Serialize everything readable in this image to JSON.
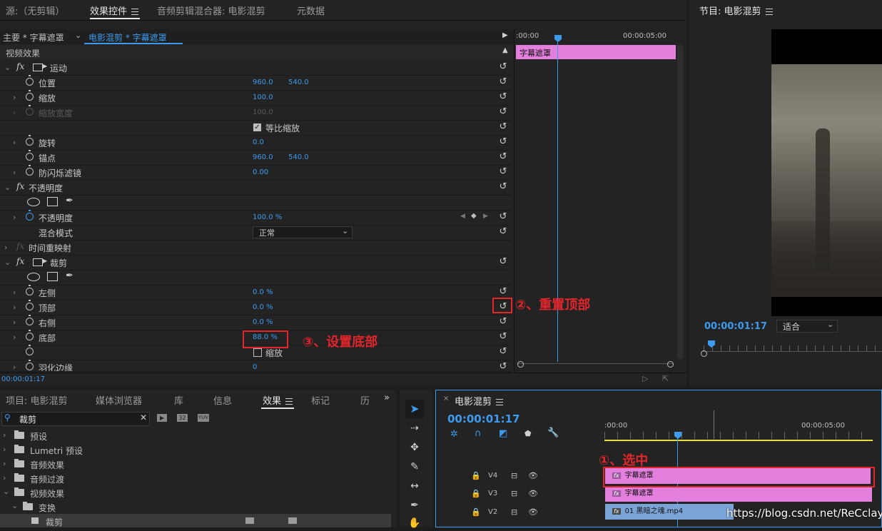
{
  "effect_controls_panel": {
    "tabs": [
      {
        "label": "源:（无剪辑）"
      },
      {
        "label": "效果控件"
      },
      {
        "label": "音频剪辑混合器: 电影混剪"
      },
      {
        "label": "元数据"
      }
    ],
    "master_label": "主要 * 字幕遮罩",
    "sequence_clip_label": "电影混剪 * 字幕遮罩",
    "section_label": "视频效果",
    "mini_timeline": {
      "time_start": ":00:00",
      "time_end": "00:00:05:00",
      "clip_label": "字幕遮罩"
    },
    "footer_time": "00:00:01:17",
    "rows": {
      "motion": "运动",
      "position": {
        "label": "位置",
        "x": "960.0",
        "y": "540.0"
      },
      "scale": {
        "label": "缩放",
        "value": "100.0"
      },
      "scale_width": {
        "label": "缩放宽度",
        "value": "100.0"
      },
      "uniform_scale": "等比缩放",
      "rotation": {
        "label": "旋转",
        "value": "0.0"
      },
      "anchor": {
        "label": "锚点",
        "x": "960.0",
        "y": "540.0"
      },
      "antiflicker": {
        "label": "防闪烁滤镜",
        "value": "0.00"
      },
      "opacity_group": "不透明度",
      "opacity": {
        "label": "不透明度",
        "value": "100.0 %"
      },
      "blend_mode": {
        "label": "混合模式",
        "value": "正常"
      },
      "time_remap": "时间重映射",
      "crop": "裁剪",
      "left": {
        "label": "左侧",
        "value": "0.0 %"
      },
      "top": {
        "label": "顶部",
        "value": "0.0 %"
      },
      "right": {
        "label": "右侧",
        "value": "0.0 %"
      },
      "bottom": {
        "label": "底部",
        "value": "88.0 %"
      },
      "zoom_checkbox": "缩放",
      "feather": {
        "label": "羽化边缘",
        "value": "0"
      }
    }
  },
  "annotations": {
    "step1": "①、选中",
    "step2": "②、重置顶部",
    "step3": "③、设置底部"
  },
  "program_monitor": {
    "title": "节目: 电影混剪",
    "timecode": "00:00:01:17",
    "fit_label": "适合"
  },
  "project_panel": {
    "tabs": [
      {
        "label": "项目: 电影混剪"
      },
      {
        "label": "媒体浏览器"
      },
      {
        "label": "库"
      },
      {
        "label": "信息"
      },
      {
        "label": "效果"
      },
      {
        "label": "标记"
      },
      {
        "label": "历"
      }
    ],
    "search_value": "裁剪",
    "tree": [
      {
        "label": "预设"
      },
      {
        "label": "Lumetri 预设"
      },
      {
        "label": "音频效果"
      },
      {
        "label": "音频过渡"
      },
      {
        "label": "视频效果"
      },
      {
        "label": "变换"
      },
      {
        "label": "裁剪"
      }
    ]
  },
  "timeline": {
    "title": "电影混剪",
    "timecode": "00:00:01:17",
    "ruler_start": ":00:00",
    "ruler_end": "00:00:05:00",
    "tracks": [
      {
        "name": "V4",
        "clip": "字幕遮罩"
      },
      {
        "name": "V3",
        "clip": "字幕遮罩"
      },
      {
        "name": "V2",
        "clip": "01 黑暗之魂.mp4"
      }
    ]
  },
  "watermark": "https://blog.csdn.net/ReCclay",
  "colors": {
    "accent_blue": "#3d9bef",
    "clip_pink": "#e37fdc",
    "annotation_red": "#e2262b",
    "clip_blue": "#7aa4d6"
  }
}
